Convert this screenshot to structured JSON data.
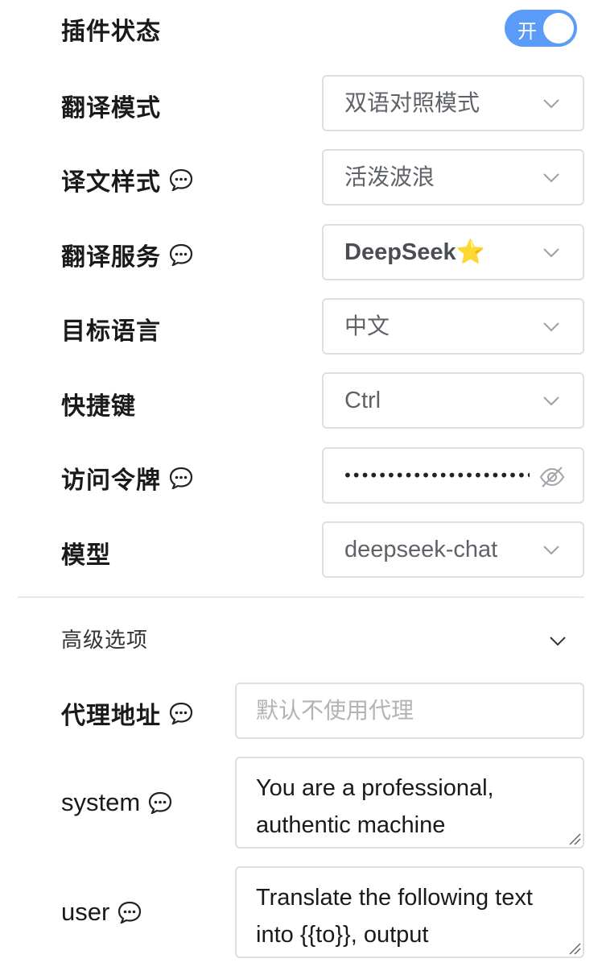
{
  "settings": {
    "plugin_status": {
      "label": "插件状态",
      "toggle_text": "开",
      "enabled": true
    },
    "translate_mode": {
      "label": "翻译模式",
      "value": "双语对照模式"
    },
    "translation_style": {
      "label": "译文样式",
      "value": "活泼波浪"
    },
    "translate_service": {
      "label": "翻译服务",
      "value": "DeepSeek⭐️"
    },
    "target_language": {
      "label": "目标语言",
      "value": "中文"
    },
    "shortcut": {
      "label": "快捷键",
      "value": "Ctrl"
    },
    "access_token": {
      "label": "访问令牌",
      "masked_value": "••••••••••••••••••••••"
    },
    "model": {
      "label": "模型",
      "value": "deepseek-chat"
    }
  },
  "advanced": {
    "title": "高级选项",
    "proxy": {
      "label": "代理地址",
      "placeholder": "默认不使用代理"
    },
    "system": {
      "label": "system",
      "value": "You are a professional, authentic machine"
    },
    "user": {
      "label": "user",
      "value": "Translate the following text into {{to}}, output"
    }
  },
  "colors": {
    "accent": "#5b9cf8",
    "border": "#dcdfe6",
    "text": "#1a1a1a",
    "muted": "#5f6368",
    "placeholder": "#b3b3b3"
  },
  "icons": [
    "help-chat-icon",
    "chevron-down-icon",
    "eye-off-icon",
    "resize-grip-icon"
  ]
}
